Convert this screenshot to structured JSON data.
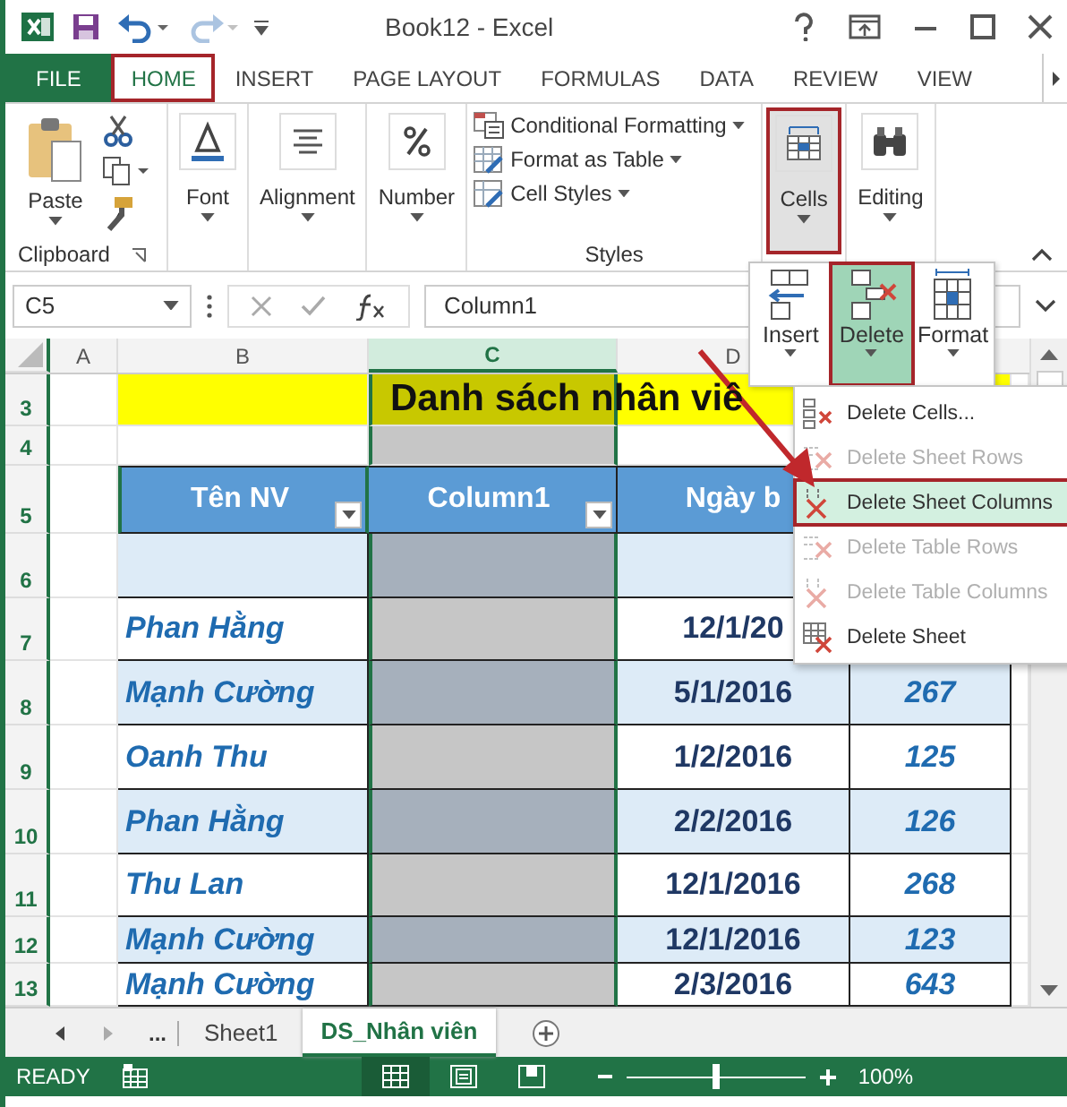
{
  "title_bar": {
    "title": "Book12 - Excel",
    "quick_access": [
      {
        "kind": "save",
        "disabled": false
      },
      {
        "kind": "undo",
        "disabled": false
      },
      {
        "kind": "redo",
        "disabled": true
      }
    ]
  },
  "ribbon_tabs": [
    {
      "label": "FILE",
      "kind": "file",
      "selected": false,
      "annotated": false
    },
    {
      "label": "HOME",
      "kind": "tab",
      "selected": true,
      "annotated": true
    },
    {
      "label": "INSERT",
      "kind": "tab",
      "selected": false,
      "annotated": false
    },
    {
      "label": "PAGE LAYOUT",
      "kind": "tab",
      "selected": false,
      "annotated": false
    },
    {
      "label": "FORMULAS",
      "kind": "tab",
      "selected": false,
      "annotated": false
    },
    {
      "label": "DATA",
      "kind": "tab",
      "selected": false,
      "annotated": false
    },
    {
      "label": "REVIEW",
      "kind": "tab",
      "selected": false,
      "annotated": false
    },
    {
      "label": "VIEW",
      "kind": "tab",
      "selected": false,
      "annotated": false
    }
  ],
  "ribbon": {
    "paste": "Paste",
    "clipboard_label": "Clipboard",
    "collapsed_groups": [
      {
        "label": "Font",
        "kind": "font"
      },
      {
        "label": "Alignment",
        "kind": "alignment"
      },
      {
        "label": "Number",
        "kind": "number"
      }
    ],
    "styles": {
      "label": "Styles",
      "items": [
        {
          "label": "Conditional Formatting",
          "kind": "conditional"
        },
        {
          "label": "Format as Table",
          "kind": "table"
        },
        {
          "label": "Cell Styles",
          "kind": "styles"
        }
      ]
    },
    "right_buttons": [
      {
        "label": "Cells",
        "kind": "cells",
        "selected": true,
        "annotated": true
      },
      {
        "label": "Editing",
        "kind": "editing",
        "selected": false,
        "annotated": false
      }
    ]
  },
  "formula_bar": {
    "name_box": "C5",
    "value": "Column1"
  },
  "sheet": {
    "columns": [
      {
        "label": "A",
        "selected": false
      },
      {
        "label": "B",
        "selected": false
      },
      {
        "label": "C",
        "selected": true
      },
      {
        "label": "D",
        "selected": false
      }
    ],
    "title": {
      "row": "3",
      "text": "Danh sách nhân viê"
    },
    "blank_row": "4",
    "header": {
      "row": "5",
      "cells": [
        {
          "text": "Tên NV",
          "filter": true
        },
        {
          "text": "Column1",
          "filter": true
        },
        {
          "text": "Ngày b",
          "filter": false
        }
      ]
    },
    "rows": [
      {
        "number": "6"
      },
      {
        "number": "7",
        "name": "Phan Hằng",
        "date": "12/1/20"
      },
      {
        "number": "8",
        "name": "Mạnh Cường",
        "date": "5/1/2016",
        "value": "267"
      },
      {
        "number": "9",
        "name": "Oanh Thu",
        "date": "1/2/2016",
        "value": "125"
      },
      {
        "number": "10",
        "name": "Phan Hằng",
        "date": "2/2/2016",
        "value": "126"
      },
      {
        "number": "11",
        "name": "Thu Lan",
        "date": "12/1/2016",
        "value": "268"
      },
      {
        "number": "12",
        "name": "Mạnh Cường",
        "date": "12/1/2016",
        "value": "123"
      },
      {
        "number": "13",
        "name": "Mạnh Cường",
        "date": "2/3/2016",
        "value": "643"
      }
    ]
  },
  "cells_menu": {
    "gallery": [
      {
        "label": "Insert",
        "kind": "insert",
        "selected": false,
        "annotated": false
      },
      {
        "label": "Delete",
        "kind": "delete",
        "selected": true,
        "annotated": true
      },
      {
        "label": "Format",
        "kind": "format",
        "selected": false,
        "annotated": false
      }
    ],
    "items": [
      {
        "label": "Delete Cells...",
        "kind": "cells",
        "disabled": false,
        "selected": false,
        "annotated": false
      },
      {
        "label": "Delete Sheet Rows",
        "kind": "rows",
        "disabled": true,
        "selected": false,
        "annotated": false
      },
      {
        "label": "Delete Sheet Columns",
        "kind": "columns",
        "disabled": false,
        "selected": true,
        "annotated": true
      },
      {
        "label": "Delete Table Rows",
        "kind": "rows",
        "disabled": true,
        "selected": false,
        "annotated": false
      },
      {
        "label": "Delete Table Columns",
        "kind": "columns",
        "disabled": true,
        "selected": false,
        "annotated": false
      },
      {
        "label": "Delete Sheet",
        "kind": "sheet",
        "disabled": false,
        "selected": false,
        "annotated": false
      }
    ]
  },
  "sheet_tabs": {
    "more": "...",
    "tabs": [
      {
        "label": "Sheet1",
        "selected": false
      },
      {
        "label": "DS_Nhân viên",
        "selected": true
      }
    ]
  },
  "status_bar": {
    "status": "READY",
    "views": [
      {
        "kind": "normal",
        "selected": true
      },
      {
        "kind": "page_layout",
        "selected": false
      },
      {
        "kind": "page_break",
        "selected": false
      }
    ],
    "zoom": {
      "level": 0.5,
      "reading": "100%"
    }
  }
}
